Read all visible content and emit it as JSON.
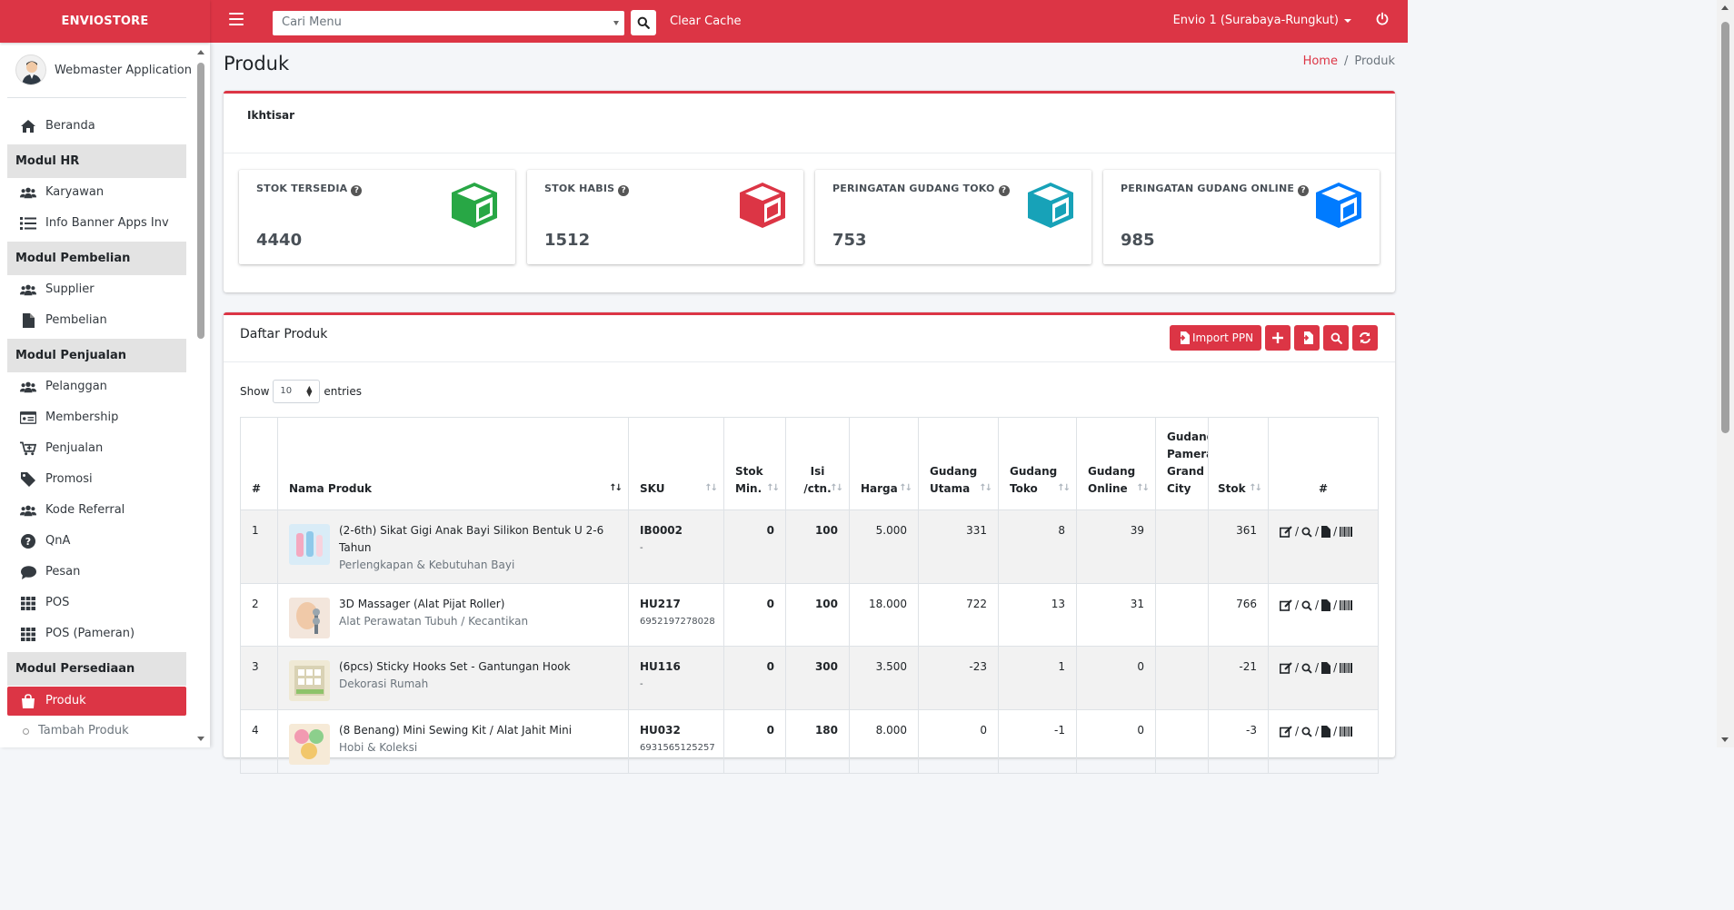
{
  "brand": "ENVIOSTORE",
  "topbar": {
    "search_placeholder": "Cari Menu",
    "clear_cache": "Clear Cache",
    "branch": "Envio 1 (Surabaya-Rungkut)"
  },
  "sidebar": {
    "user": "Webmaster Application",
    "beranda": "Beranda",
    "hr_header": "Modul HR",
    "karyawan": "Karyawan",
    "info_banner": "Info Banner Apps Inv",
    "pembelian_header": "Modul Pembelian",
    "supplier": "Supplier",
    "pembelian": "Pembelian",
    "penjualan_header": "Modul Penjualan",
    "pelanggan": "Pelanggan",
    "membership": "Membership",
    "penjualan": "Penjualan",
    "promosi": "Promosi",
    "kode_referral": "Kode Referral",
    "qna": "QnA",
    "pesan": "Pesan",
    "pos": "POS",
    "pos_pameran": "POS (Pameran)",
    "persediaan_header": "Modul Persediaan",
    "produk": "Produk",
    "tambah_produk": "Tambah Produk"
  },
  "page": {
    "title": "Produk",
    "breadcrumb_home": "Home",
    "breadcrumb_current": "Produk"
  },
  "overview": {
    "title": "Ikhtisar",
    "stats": [
      {
        "label": "STOK TERSEDIA",
        "value": "4440",
        "color": "#28a745"
      },
      {
        "label": "STOK HABIS",
        "value": "1512",
        "color": "#dc3545"
      },
      {
        "label": "PERINGATAN GUDANG TOKO",
        "value": "753",
        "color": "#17a2b8"
      },
      {
        "label": "PERINGATAN GUDANG ONLINE",
        "value": "985",
        "color": "#007bff"
      }
    ]
  },
  "products": {
    "title": "Daftar Produk",
    "import_label": "Import PPN",
    "show_label": "Show",
    "show_value": "10",
    "entries_label": "entries",
    "columns": {
      "no": "#",
      "name": "Nama Produk",
      "sku": "SKU",
      "stok_min": "Stok Min.",
      "isi": "Isi /ctn.",
      "harga": "Harga",
      "gudang_utama": "Gudang Utama",
      "gudang_toko": "Gudang Toko",
      "gudang_online": "Gudang Online",
      "gudang_pameran": "Gudang Pameran Grand City",
      "stok": "Stok",
      "action": "#"
    },
    "rows": [
      {
        "no": "1",
        "name": "(2-6th) Sikat Gigi Anak Bayi Silikon Bentuk U 2-6 Tahun",
        "category": "Perlengkapan & Kebutuhan Bayi",
        "sku": "IB0002",
        "barcode": "-",
        "stok_min": "0",
        "isi": "100",
        "harga": "5.000",
        "gudang_utama": "331",
        "gudang_toko": "8",
        "gudang_online": "39",
        "gudang_pameran": "",
        "stok": "361"
      },
      {
        "no": "2",
        "name": "3D Massager (Alat Pijat Roller)",
        "category": "Alat Perawatan Tubuh / Kecantikan",
        "sku": "HU217",
        "barcode": "6952197278028",
        "stok_min": "0",
        "isi": "100",
        "harga": "18.000",
        "gudang_utama": "722",
        "gudang_toko": "13",
        "gudang_online": "31",
        "gudang_pameran": "",
        "stok": "766"
      },
      {
        "no": "3",
        "name": "(6pcs) Sticky Hooks Set - Gantungan Hook",
        "category": "Dekorasi Rumah",
        "sku": "HU116",
        "barcode": "-",
        "stok_min": "0",
        "isi": "300",
        "harga": "3.500",
        "gudang_utama": "-23",
        "gudang_toko": "1",
        "gudang_online": "0",
        "gudang_pameran": "",
        "stok": "-21"
      },
      {
        "no": "4",
        "name": "(8 Benang) Mini Sewing Kit / Alat Jahit Mini",
        "category": "Hobi & Koleksi",
        "sku": "HU032",
        "barcode": "6931565125257",
        "stok_min": "0",
        "isi": "180",
        "harga": "8.000",
        "gudang_utama": "0",
        "gudang_toko": "-1",
        "gudang_online": "0",
        "gudang_pameran": "",
        "stok": "-3"
      }
    ]
  }
}
